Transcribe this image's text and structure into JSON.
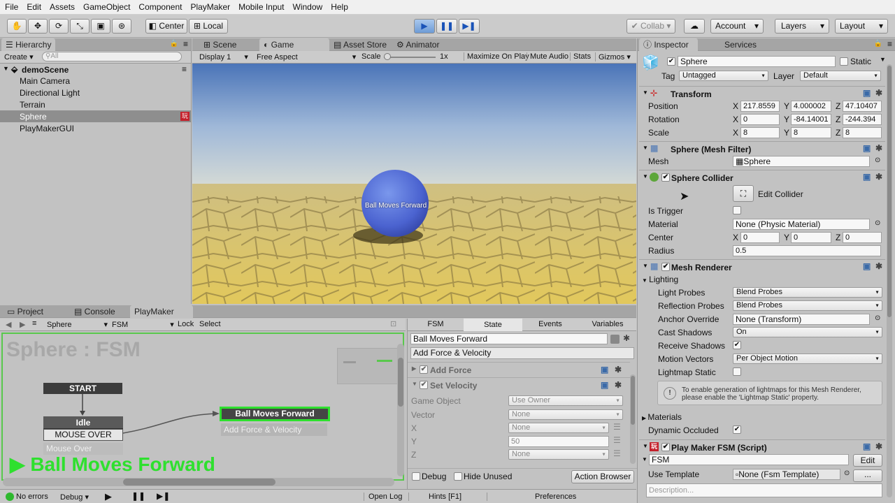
{
  "menu": [
    "File",
    "Edit",
    "Assets",
    "GameObject",
    "Component",
    "PlayMaker",
    "Mobile Input",
    "Window",
    "Help"
  ],
  "toolbar": {
    "center": "Center",
    "local": "Local",
    "collab": "Collab",
    "account": "Account",
    "layers": "Layers",
    "layout": "Layout"
  },
  "hierarchy": {
    "tab": "Hierarchy",
    "create": "Create",
    "search": "All",
    "scene": "demoScene",
    "items": [
      "Main Camera",
      "Directional Light",
      "Terrain",
      "Sphere",
      "PlayMakerGUI"
    ]
  },
  "game": {
    "tabs": [
      "Scene",
      "Game",
      "Asset Store",
      "Animator"
    ],
    "display": "Display 1",
    "aspect": "Free Aspect",
    "scale_label": "Scale",
    "scale_value": "1x",
    "options": [
      "Maximize On Play",
      "Mute Audio",
      "Stats",
      "Gizmos"
    ],
    "ball_label": "Ball Moves Forward"
  },
  "bottom_tabs": [
    "Project",
    "Console",
    "PlayMaker"
  ],
  "fsm": {
    "object": "Sphere",
    "fsm": "FSM",
    "lock": "Lock",
    "select": "Select",
    "title": "Sphere : FSM",
    "start": "START",
    "idle": "Idle",
    "mouse_over_event": "MOUSE OVER",
    "active_state": "Ball Moves Forward",
    "active_desc": "Add Force & Velocity",
    "mouse_over_label": "Mouse Over",
    "big_label": "Ball Moves Forward"
  },
  "state_panel": {
    "tabs": [
      "FSM",
      "State",
      "Events",
      "Variables"
    ],
    "state_name": "Ball Moves Forward",
    "description": "Add Force & Velocity",
    "actions": [
      "Add Force",
      "Set Velocity"
    ],
    "rows": [
      {
        "label": "Game Object",
        "value": "Use Owner"
      },
      {
        "label": "Vector",
        "value": "None"
      },
      {
        "label": "X",
        "value": "None"
      },
      {
        "label": "Y",
        "value": "50"
      },
      {
        "label": "Z",
        "value": "None"
      }
    ],
    "debug": "Debug",
    "hide_unused": "Hide Unused",
    "action_browser": "Action Browser",
    "hints": "Hints [F1]",
    "preferences": "Preferences"
  },
  "status": {
    "errors": "No errors",
    "debug": "Debug",
    "open_log": "Open Log"
  },
  "inspector": {
    "tabs": [
      "Inspector",
      "Services"
    ],
    "name": "Sphere",
    "static": "Static",
    "tag_label": "Tag",
    "tag": "Untagged",
    "layer_label": "Layer",
    "layer": "Default",
    "transform": {
      "title": "Transform",
      "position_label": "Position",
      "position": [
        "217.8559",
        "4.000002",
        "47.10407"
      ],
      "rotation_label": "Rotation",
      "rotation": [
        "0",
        "-84.14001",
        "-244.394"
      ],
      "scale_label": "Scale",
      "scale": [
        "8",
        "8",
        "8"
      ]
    },
    "mesh_filter": {
      "title": "Sphere (Mesh Filter)",
      "mesh_label": "Mesh",
      "mesh": "Sphere"
    },
    "collider": {
      "title": "Sphere Collider",
      "edit": "Edit Collider",
      "trigger": "Is Trigger",
      "material_label": "Material",
      "material": "None (Physic Material)",
      "center_label": "Center",
      "center": [
        "0",
        "0",
        "0"
      ],
      "radius_label": "Radius",
      "radius": "0.5"
    },
    "renderer": {
      "title": "Mesh Renderer",
      "lighting": "Lighting",
      "rows": [
        {
          "label": "Light Probes",
          "value": "Blend Probes"
        },
        {
          "label": "Reflection Probes",
          "value": "Blend Probes"
        },
        {
          "label": "Anchor Override",
          "value": "None (Transform)"
        },
        {
          "label": "Cast Shadows",
          "value": "On"
        },
        {
          "label": "Receive Shadows",
          "value": ""
        },
        {
          "label": "Motion Vectors",
          "value": "Per Object Motion"
        },
        {
          "label": "Lightmap Static",
          "value": ""
        }
      ],
      "info": "To enable generation of lightmaps for this Mesh Renderer, please enable the 'Lightmap Static' property.",
      "materials": "Materials",
      "occluded": "Dynamic Occluded"
    },
    "playmaker": {
      "title": "Play Maker FSM (Script)",
      "fsm": "FSM",
      "edit": "Edit",
      "template_label": "Use Template",
      "template": "None (Fsm Template)",
      "description": "Description..."
    }
  }
}
